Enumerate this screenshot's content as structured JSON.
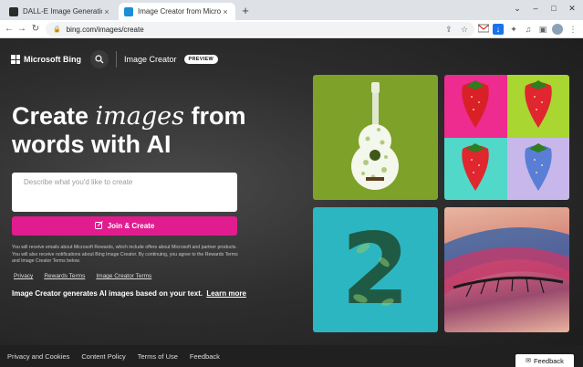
{
  "browser": {
    "tabs": [
      {
        "title": "DALL-E Image Generation Is Com",
        "favicon_color": "#2b2b2b"
      },
      {
        "title": "Image Creator from Microsoft Bi",
        "favicon_color": "#1b8ed6"
      }
    ],
    "url": "bing.com/images/create",
    "new_tab_glyph": "+",
    "close_glyph": "×",
    "nav_back_glyph": "←",
    "nav_forward_glyph": "→",
    "nav_reload_glyph": "↻",
    "minimize_glyph": "–",
    "maximize_glyph": "□",
    "close_window_glyph": "✕"
  },
  "header": {
    "brand": "Microsoft Bing",
    "product": "Image Creator",
    "badge": "PREVIEW"
  },
  "hero": {
    "line1_pre": "Create ",
    "line1_em": "images",
    "line1_post": " from",
    "line2": "words with AI"
  },
  "prompt": {
    "placeholder": "Describe what you'd like to create"
  },
  "cta": {
    "label": "Join & Create"
  },
  "fine_print": "You will receive emails about Microsoft Rewards, which include offers about Microsoft and partner products. You will also receive notifications about Bing Image Creator. By continuing, you agree to the Rewards Terms and Image Creator Terms below.",
  "links": [
    "Privacy",
    "Rewards Terms",
    "Image Creator Terms"
  ],
  "description": {
    "text": "Image Creator generates AI images based on your text.",
    "link": "Learn more"
  },
  "gallery": {
    "tile3_glyph": "2",
    "strawberry_quads": [
      "#ee2b8f",
      "#a9d631",
      "#52d8c9",
      "#c8b7ea"
    ]
  },
  "footer": {
    "links": [
      "Privacy and Cookies",
      "Content Policy",
      "Terms of Use",
      "Feedback"
    ],
    "feedback_button": "Feedback"
  },
  "colors": {
    "accent": "#e11c8f"
  }
}
